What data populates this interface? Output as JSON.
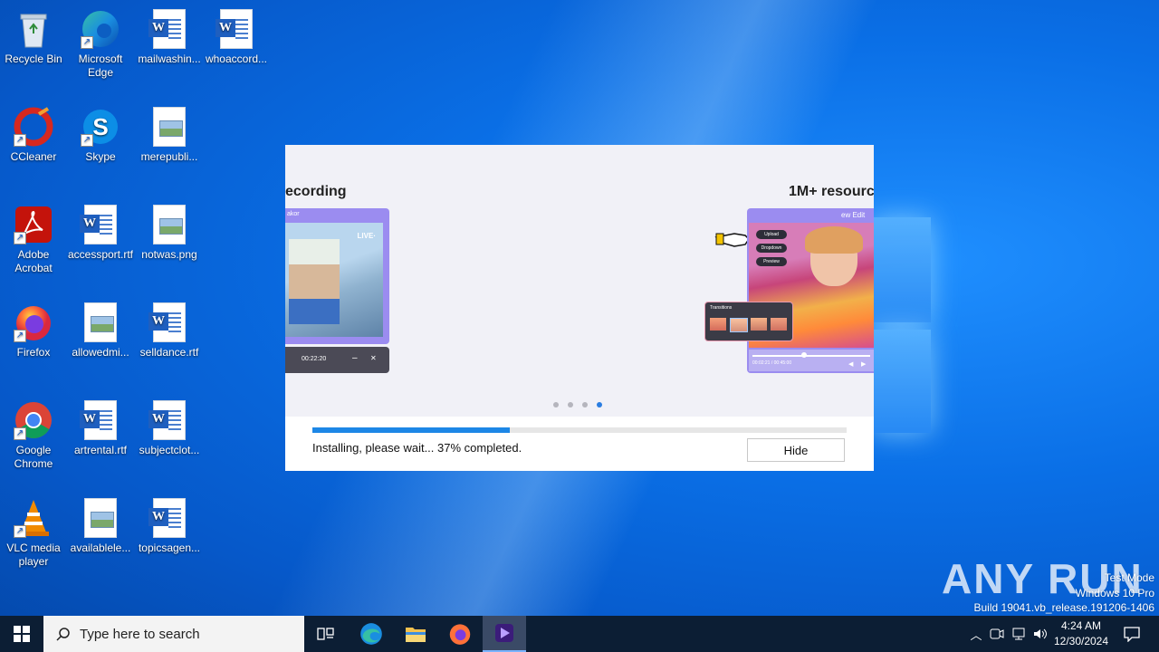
{
  "desktop": {
    "icons": [
      {
        "label": "Recycle Bin"
      },
      {
        "label": "Microsoft Edge"
      },
      {
        "label": "mailwashin..."
      },
      {
        "label": "whoaccord..."
      },
      {
        "label": "CCleaner"
      },
      {
        "label": "Skype"
      },
      {
        "label": "merepubli..."
      },
      {
        "label": "Adobe Acrobat"
      },
      {
        "label": "accessport.rtf"
      },
      {
        "label": "notwas.png"
      },
      {
        "label": "Firefox"
      },
      {
        "label": "allowedmi..."
      },
      {
        "label": "selldance.rtf"
      },
      {
        "label": "Google Chrome"
      },
      {
        "label": "artrental.rtf"
      },
      {
        "label": "subjectclot..."
      },
      {
        "label": "VLC media player"
      },
      {
        "label": "availablele..."
      },
      {
        "label": "topicsagen..."
      }
    ]
  },
  "installer": {
    "slide_left_title": "ecording",
    "slide_right_title": "1M+ resourc",
    "left_card": {
      "header": "akor",
      "live_label": "LIVE·",
      "timer": "00:22:20",
      "minimize": "–",
      "close": "✕"
    },
    "right_card": {
      "header": "ew Edit",
      "menu": [
        "Upload",
        "Dropdown",
        "Preview"
      ],
      "transitions_label": "Transitions",
      "time": "00:02:21 / 00:45:00"
    },
    "progress_percent": 37,
    "status_text": "Installing, please wait... 37% completed.",
    "hide_label": "Hide",
    "dots": 4,
    "active_dot": 3
  },
  "taskbar": {
    "search_placeholder": "Type here to search",
    "apps": [
      "task-view",
      "edge",
      "file-explorer",
      "firefox",
      "video-editor"
    ],
    "time": "4:24 AM",
    "date": "12/30/2024"
  },
  "watermark": {
    "line1": "Test Mode",
    "line2": "Windows 10 Pro",
    "line3": "Build 19041.vb_release.191206-1406",
    "brand": "ANY RUN"
  },
  "colors": {
    "accent": "#1d87e6",
    "taskbar": "#0c1e34",
    "active_app": "#3a4a66"
  }
}
